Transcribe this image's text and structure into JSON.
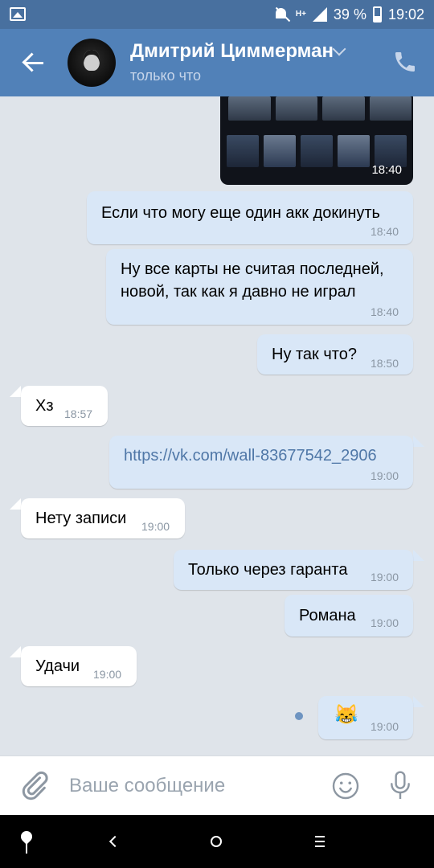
{
  "status_bar": {
    "battery": "39 %",
    "time": "19:02",
    "network": "H+"
  },
  "header": {
    "contact_name": "Дмитрий Циммерман",
    "status": "только что"
  },
  "image_message": {
    "time": "18:40"
  },
  "messages": [
    {
      "direction": "out",
      "lines": [
        "Если что могу еще один акк докинуть"
      ],
      "time": "18:40"
    },
    {
      "direction": "out",
      "lines": [
        "Ну все карты не считая последней,",
        "новой, так как я давно не играл"
      ],
      "time": "18:40"
    },
    {
      "direction": "out",
      "lines": [
        "Ну так что?"
      ],
      "time": "18:50"
    },
    {
      "direction": "in",
      "lines": [
        "Хз"
      ],
      "time": "18:57"
    },
    {
      "direction": "out",
      "lines": [
        "https://vk.com/wall-83677542_2906"
      ],
      "time": "19:00"
    },
    {
      "direction": "in",
      "lines": [
        "Нету записи"
      ],
      "time": "19:00"
    },
    {
      "direction": "out",
      "lines": [
        "Только через гаранта"
      ],
      "time": "19:00"
    },
    {
      "direction": "out",
      "lines": [
        "Романа"
      ],
      "time": "19:00"
    },
    {
      "direction": "in",
      "lines": [
        "Удачи"
      ],
      "time": "19:00"
    },
    {
      "direction": "out",
      "lines": [
        "😹"
      ],
      "time": "19:00"
    }
  ],
  "composer": {
    "placeholder": "Ваше сообщение"
  },
  "icons": {
    "attach": "paperclip-icon",
    "emoji": "smiley-icon",
    "mic": "microphone-icon",
    "call": "phone-icon",
    "back": "arrow-left-icon"
  },
  "colors": {
    "header": "#5181b8",
    "status_bar": "#48709f",
    "outgoing_bubble": "#d9e7f7",
    "incoming_bubble": "#ffffff",
    "chat_background": "#dfe4ea",
    "link": "#4f77a7"
  }
}
